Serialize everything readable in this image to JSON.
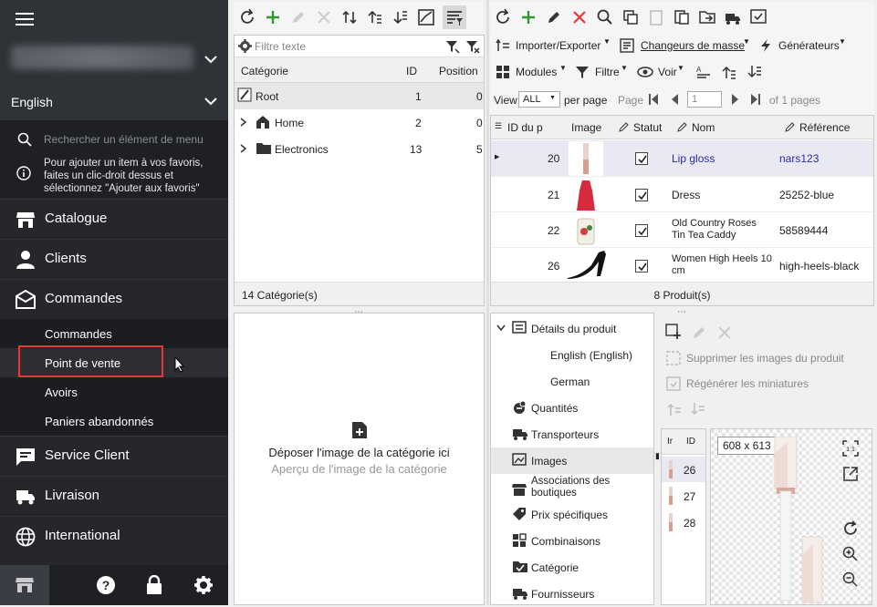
{
  "sidebar": {
    "language": "English",
    "search_placeholder": "Rechercher un élément de menu",
    "favorites_hint": "Pour ajouter un item à vos favoris, faites un clic-droit dessus et sélectionnez \"Ajouter aux favoris\"",
    "items": [
      {
        "label": "Catalogue",
        "icon": "store-icon"
      },
      {
        "label": "Clients",
        "icon": "person-icon"
      },
      {
        "label": "Commandes",
        "icon": "inbox-icon"
      },
      {
        "label": "Service Client",
        "icon": "chat-icon"
      },
      {
        "label": "Livraison",
        "icon": "truck-icon"
      },
      {
        "label": "International",
        "icon": "globe-icon"
      }
    ],
    "sub_items": [
      "Commandes",
      "Point de vente",
      "Avoirs",
      "Paniers abandonnés"
    ],
    "highlighted_sub": "Point de vente"
  },
  "category_panel": {
    "filter_placeholder": "Filtre texte",
    "columns": [
      "Catégorie",
      "ID",
      "Position"
    ],
    "rows": [
      {
        "name": "Root",
        "id": "1",
        "position": "0",
        "icon": "pen-icon"
      },
      {
        "name": "Home",
        "id": "2",
        "position": "0",
        "icon": "home-icon"
      },
      {
        "name": "Electronics",
        "id": "13",
        "position": "5",
        "icon": "folder-icon"
      }
    ],
    "footer": "14 Catégorie(s)"
  },
  "image_drop": {
    "title": "Déposer l'image de la catégorie ici",
    "subtitle": "Aperçu de l'image de la catégorie"
  },
  "products_panel": {
    "menu1": [
      "Importer/Exporter",
      "Changeurs de masse",
      "Générateurs"
    ],
    "menu2": [
      "Modules",
      "Filtre",
      "Voir"
    ],
    "view_label": "View",
    "view_value": "ALL",
    "per_page": "per page",
    "page_label": "Page",
    "page_value": "1",
    "of_pages": "of 1 pages",
    "columns": [
      "ID du p",
      "Image",
      "Statut",
      "Nom",
      "Référence"
    ],
    "rows": [
      {
        "id": "20",
        "name": "Lip gloss",
        "ref": "nars123",
        "selected": true
      },
      {
        "id": "21",
        "name": "Dress",
        "ref": "25252-blue",
        "selected": false
      },
      {
        "id": "22",
        "name": "Old Country Roses Tin Tea Caddy",
        "ref": "58589444",
        "selected": false
      },
      {
        "id": "26",
        "name": "Women High Heels 10 cm",
        "ref": "high-heels-black",
        "selected": false
      }
    ],
    "footer": "8 Produit(s)"
  },
  "details": {
    "tree": [
      {
        "label": "Détails du produit"
      },
      {
        "label": "English (English)"
      },
      {
        "label": "German"
      },
      {
        "label": "Quantités"
      },
      {
        "label": "Transporteurs"
      },
      {
        "label": "Images"
      },
      {
        "label": "Associations des boutiques"
      },
      {
        "label": "Prix spécifiques"
      },
      {
        "label": "Combinaisons"
      },
      {
        "label": "Catégorie"
      },
      {
        "label": "Fournisseurs"
      }
    ],
    "actions": [
      "Supprimer les images du produit",
      "Régénérer les miniatures"
    ],
    "img_cols": [
      "Ir",
      "ID"
    ],
    "img_rows": [
      "26",
      "27",
      "28"
    ],
    "preview_size": "608 x 613",
    "accent": "#e53935"
  }
}
